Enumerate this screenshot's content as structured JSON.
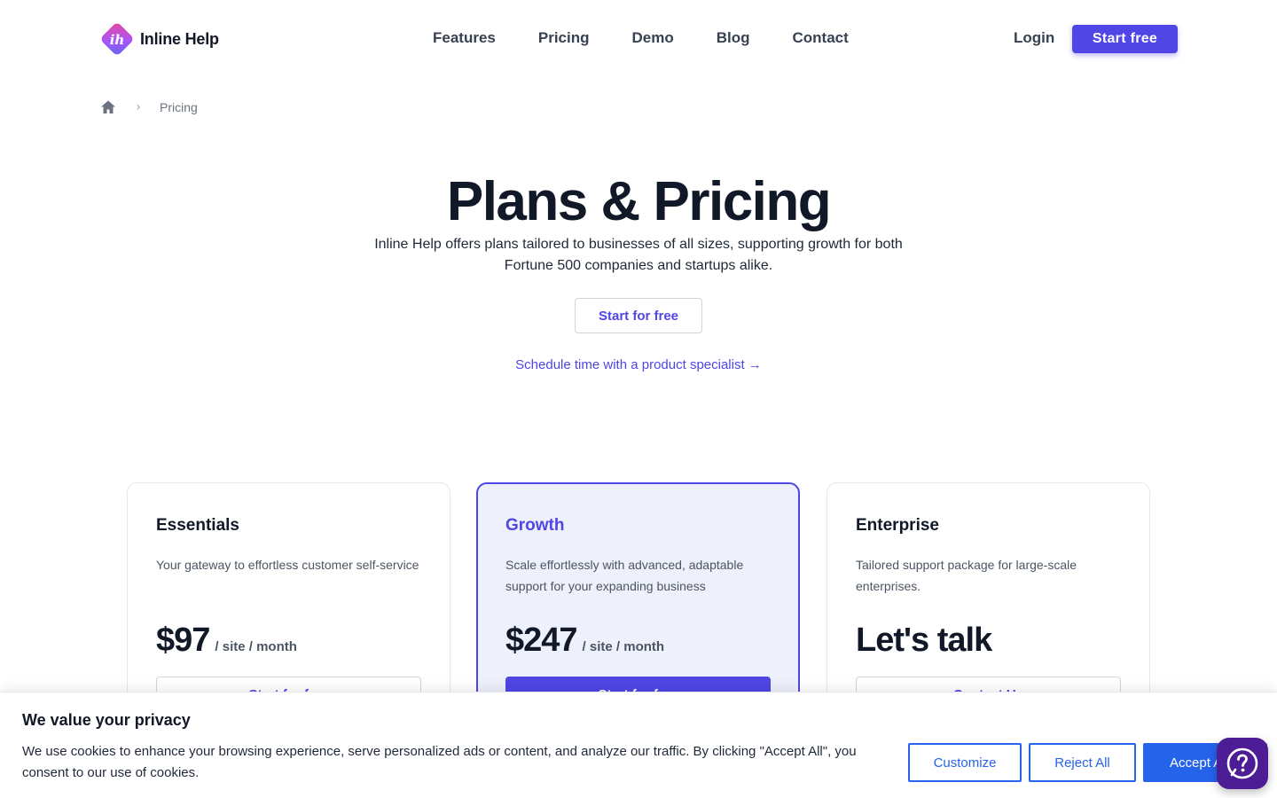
{
  "brand": {
    "name": "Inline Help",
    "logo_initials": "ih"
  },
  "nav": {
    "items": [
      {
        "label": "Features"
      },
      {
        "label": "Pricing"
      },
      {
        "label": "Demo"
      },
      {
        "label": "Blog"
      },
      {
        "label": "Contact"
      }
    ],
    "login_label": "Login",
    "cta_label": "Start free"
  },
  "breadcrumb": {
    "current": "Pricing",
    "separator": "›"
  },
  "hero": {
    "title": "Plans & Pricing",
    "subtitle": "Inline Help offers plans tailored to businesses of all sizes, supporting growth for both Fortune 500 companies and startups alike.",
    "cta_label": "Start for free",
    "link_label": "Schedule time with a product specialist →"
  },
  "plans": [
    {
      "name": "Essentials",
      "description": "Your gateway to effortless customer self-service",
      "price": "$97",
      "period": "/ site / month",
      "cta": "Start for free"
    },
    {
      "name": "Growth",
      "description": "Scale effortlessly with advanced, adaptable support for your expanding business",
      "price": "$247",
      "period": "/ site / month",
      "cta": "Start for free"
    },
    {
      "name": "Enterprise",
      "description": "Tailored support package for large-scale enterprises.",
      "price": "Let's talk",
      "period": "",
      "cta": "Contact Us"
    }
  ],
  "cookie": {
    "title": "We value your privacy",
    "text": "We use cookies to enhance your browsing experience, serve personalized ads or content, and analyze our traffic. By clicking \"Accept All\", you consent to our use of cookies.",
    "customize_label": "Customize",
    "reject_label": "Reject All",
    "accept_label": "Accept All"
  },
  "icons": {
    "home": "home-icon",
    "help": "help-question-icon",
    "logo": "inline-help-logo-icon"
  },
  "colors": {
    "accent": "#4f46e5",
    "cookie_accent": "#2563eb",
    "help_widget": "#4c1d95",
    "featured_bg": "#eef0fb"
  }
}
